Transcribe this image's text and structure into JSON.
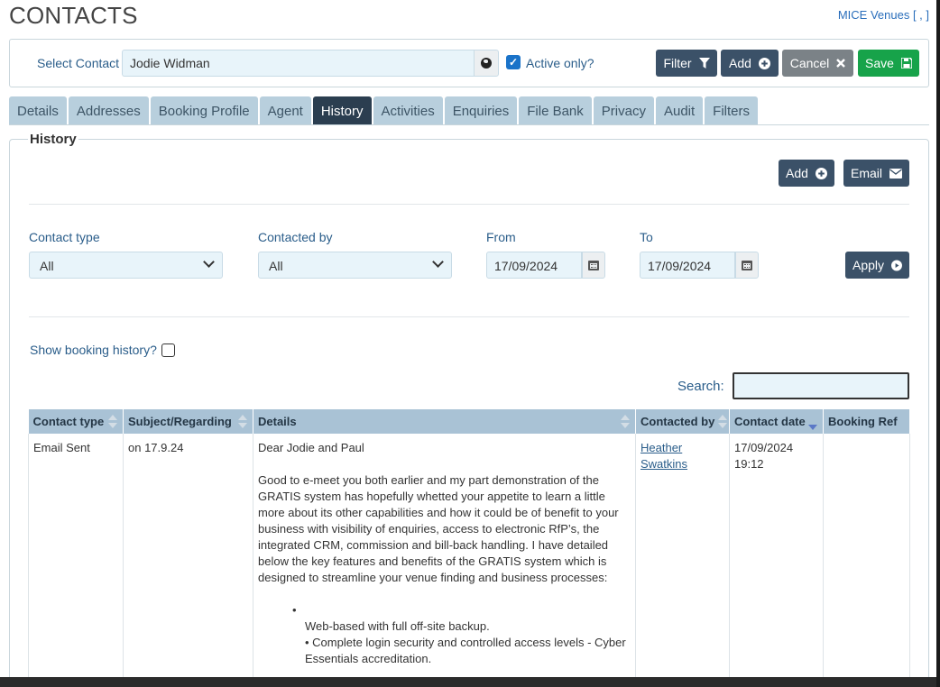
{
  "header": {
    "title": "CONTACTS",
    "top_right_link": "MICE Venues [ , ]"
  },
  "contact_bar": {
    "select_label": "Select Contact",
    "contact_value": "Jodie Widman",
    "active_only_label": "Active only?",
    "active_only_checked": true,
    "filter_label": "Filter",
    "add_label": "Add",
    "cancel_label": "Cancel",
    "save_label": "Save"
  },
  "tabs": [
    {
      "label": "Details"
    },
    {
      "label": "Addresses"
    },
    {
      "label": "Booking Profile"
    },
    {
      "label": "Agent"
    },
    {
      "label": "History",
      "active": true
    },
    {
      "label": "Activities"
    },
    {
      "label": "Enquiries"
    },
    {
      "label": "File Bank"
    },
    {
      "label": "Privacy"
    },
    {
      "label": "Audit"
    },
    {
      "label": "Filters"
    }
  ],
  "history": {
    "legend": "History",
    "add_label": "Add",
    "email_label": "Email",
    "filters": {
      "contact_type_label": "Contact type",
      "contact_type_value": "All",
      "contacted_by_label": "Contacted by",
      "contacted_by_value": "All",
      "from_label": "From",
      "from_value": "17/09/2024",
      "to_label": "To",
      "to_value": "17/09/2024",
      "apply_label": "Apply"
    },
    "show_booking_history_label": "Show booking history?",
    "search_label": "Search:",
    "columns": [
      "Contact type",
      "Subject/Regarding",
      "Details",
      "Contacted by",
      "Contact date",
      "Booking Ref"
    ],
    "rows": [
      {
        "contact_type": "Email Sent",
        "subject": "on 17.9.24",
        "details_greeting": "Dear Jodie and Paul",
        "details_body": "Good to e-meet you both earlier and my part demonstration of the GRATIS system has hopefully whetted your appetite to learn a little more about its other capabilities and how it could be of benefit to your business with visibility of enquiries, access to electronic RfP’s, the integrated CRM, commission and bill-back handling. I have detailed below the key features and benefits of the GRATIS system which is designed to streamline your venue finding and business processes:",
        "bullet_marker": "•",
        "bullet_1": "Web-based with full off-site backup.",
        "bullet_2": "• Complete login security and controlled access levels - Cyber Essentials accreditation.",
        "contacted_by_first": "Heather",
        "contacted_by_last": "Swatkins",
        "contact_date": "17/09/2024",
        "contact_time": "19:12",
        "booking_ref": ""
      }
    ]
  }
}
